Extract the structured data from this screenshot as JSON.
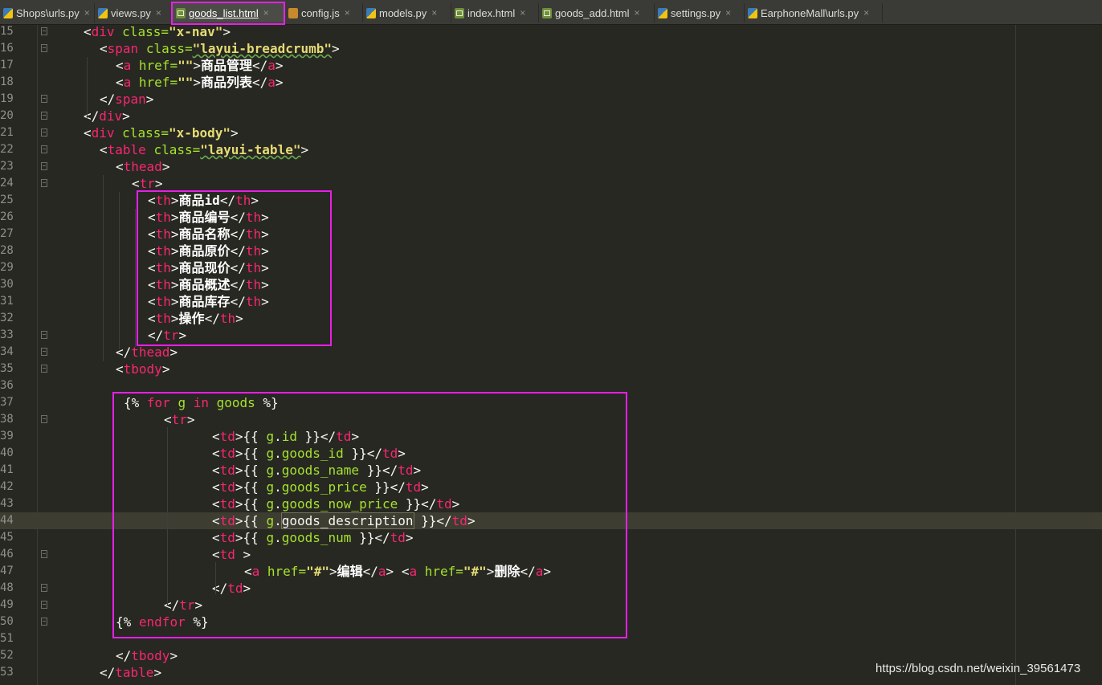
{
  "tabs": [
    {
      "label": "Shops\\urls.py",
      "icon": "python-file-icon",
      "active": false
    },
    {
      "label": "views.py",
      "icon": "python-file-icon",
      "active": false
    },
    {
      "label": "goods_list.html",
      "icon": "html-file-icon",
      "active": true
    },
    {
      "label": "config.js",
      "icon": "js-file-icon",
      "active": false
    },
    {
      "label": "models.py",
      "icon": "python-file-icon",
      "active": false
    },
    {
      "label": "index.html",
      "icon": "html-file-icon",
      "active": false
    },
    {
      "label": "goods_add.html",
      "icon": "html-file-icon",
      "active": false
    },
    {
      "label": "settings.py",
      "icon": "python-file-icon",
      "active": false
    },
    {
      "label": "EarphoneMall\\urls.py",
      "icon": "python-file-icon",
      "active": false
    }
  ],
  "tab_close_glyph": "×",
  "lines": [
    {
      "num": "15",
      "tokens": [
        [
          "punc",
          "<"
        ],
        [
          "tag",
          "div "
        ],
        [
          "attr",
          "class="
        ],
        [
          "str",
          "\"x-nav\""
        ],
        [
          "punc",
          ">"
        ]
      ]
    },
    {
      "num": "16",
      "tokens": [
        [
          "punc",
          "<"
        ],
        [
          "tag",
          "span "
        ],
        [
          "attr",
          "class="
        ],
        [
          "str",
          "\"layui-breadcrumb\""
        ],
        [
          "punc",
          ">"
        ]
      ]
    },
    {
      "num": "17",
      "tokens": [
        [
          "punc",
          "<"
        ],
        [
          "tag",
          "a "
        ],
        [
          "attr",
          "href="
        ],
        [
          "str",
          "\"\""
        ],
        [
          "punc",
          ">"
        ],
        [
          "txt",
          "商品管理"
        ],
        [
          "punc",
          "</"
        ],
        [
          "tag",
          "a"
        ],
        [
          "punc",
          ">"
        ]
      ]
    },
    {
      "num": "18",
      "tokens": [
        [
          "punc",
          "<"
        ],
        [
          "tag",
          "a "
        ],
        [
          "attr",
          "href="
        ],
        [
          "str",
          "\"\""
        ],
        [
          "punc",
          ">"
        ],
        [
          "txt",
          "商品列表"
        ],
        [
          "punc",
          "</"
        ],
        [
          "tag",
          "a"
        ],
        [
          "punc",
          ">"
        ]
      ]
    },
    {
      "num": "19",
      "tokens": [
        [
          "punc",
          "</"
        ],
        [
          "tag",
          "span"
        ],
        [
          "punc",
          ">"
        ]
      ]
    },
    {
      "num": "20",
      "tokens": [
        [
          "punc",
          "</"
        ],
        [
          "tag",
          "div"
        ],
        [
          "punc",
          ">"
        ]
      ]
    },
    {
      "num": "21",
      "tokens": [
        [
          "punc",
          "<"
        ],
        [
          "tag",
          "div "
        ],
        [
          "attr",
          "class="
        ],
        [
          "str",
          "\"x-body\""
        ],
        [
          "punc",
          ">"
        ]
      ]
    },
    {
      "num": "22",
      "tokens": [
        [
          "punc",
          "<"
        ],
        [
          "tag",
          "table "
        ],
        [
          "attr",
          "class="
        ],
        [
          "str",
          "\"layui-table\""
        ],
        [
          "punc",
          ">"
        ]
      ]
    },
    {
      "num": "23",
      "tokens": [
        [
          "punc",
          "<"
        ],
        [
          "tag",
          "thead"
        ],
        [
          "punc",
          ">"
        ]
      ]
    },
    {
      "num": "24",
      "tokens": [
        [
          "punc",
          "<"
        ],
        [
          "tag",
          "tr"
        ],
        [
          "punc",
          ">"
        ]
      ]
    },
    {
      "num": "25",
      "tokens": [
        [
          "punc",
          "<"
        ],
        [
          "tag",
          "th"
        ],
        [
          "punc",
          ">"
        ],
        [
          "txt",
          "商品id"
        ],
        [
          "punc",
          "</"
        ],
        [
          "tag",
          "th"
        ],
        [
          "punc",
          ">"
        ]
      ]
    },
    {
      "num": "26",
      "tokens": [
        [
          "punc",
          "<"
        ],
        [
          "tag",
          "th"
        ],
        [
          "punc",
          ">"
        ],
        [
          "txt",
          "商品编号"
        ],
        [
          "punc",
          "</"
        ],
        [
          "tag",
          "th"
        ],
        [
          "punc",
          ">"
        ]
      ]
    },
    {
      "num": "27",
      "tokens": [
        [
          "punc",
          "<"
        ],
        [
          "tag",
          "th"
        ],
        [
          "punc",
          ">"
        ],
        [
          "txt",
          "商品名称"
        ],
        [
          "punc",
          "</"
        ],
        [
          "tag",
          "th"
        ],
        [
          "punc",
          ">"
        ]
      ]
    },
    {
      "num": "28",
      "tokens": [
        [
          "punc",
          "<"
        ],
        [
          "tag",
          "th"
        ],
        [
          "punc",
          ">"
        ],
        [
          "txt",
          "商品原价"
        ],
        [
          "punc",
          "</"
        ],
        [
          "tag",
          "th"
        ],
        [
          "punc",
          ">"
        ]
      ]
    },
    {
      "num": "29",
      "tokens": [
        [
          "punc",
          "<"
        ],
        [
          "tag",
          "th"
        ],
        [
          "punc",
          ">"
        ],
        [
          "txt",
          "商品现价"
        ],
        [
          "punc",
          "</"
        ],
        [
          "tag",
          "th"
        ],
        [
          "punc",
          ">"
        ]
      ]
    },
    {
      "num": "30",
      "tokens": [
        [
          "punc",
          "<"
        ],
        [
          "tag",
          "th"
        ],
        [
          "punc",
          ">"
        ],
        [
          "txt",
          "商品概述"
        ],
        [
          "punc",
          "</"
        ],
        [
          "tag",
          "th"
        ],
        [
          "punc",
          ">"
        ]
      ]
    },
    {
      "num": "31",
      "tokens": [
        [
          "punc",
          "<"
        ],
        [
          "tag",
          "th"
        ],
        [
          "punc",
          ">"
        ],
        [
          "txt",
          "商品库存"
        ],
        [
          "punc",
          "</"
        ],
        [
          "tag",
          "th"
        ],
        [
          "punc",
          ">"
        ]
      ]
    },
    {
      "num": "32",
      "tokens": [
        [
          "punc",
          "<"
        ],
        [
          "tag",
          "th"
        ],
        [
          "punc",
          ">"
        ],
        [
          "txt",
          "操作"
        ],
        [
          "punc",
          "</"
        ],
        [
          "tag",
          "th"
        ],
        [
          "punc",
          ">"
        ]
      ]
    },
    {
      "num": "33",
      "tokens": [
        [
          "punc",
          "</"
        ],
        [
          "tag",
          "tr"
        ],
        [
          "punc",
          ">"
        ]
      ]
    },
    {
      "num": "34",
      "tokens": [
        [
          "punc",
          "</"
        ],
        [
          "tag",
          "thead"
        ],
        [
          "punc",
          ">"
        ]
      ]
    },
    {
      "num": "35",
      "tokens": [
        [
          "punc",
          "<"
        ],
        [
          "tag",
          "tbody"
        ],
        [
          "punc",
          ">"
        ]
      ]
    },
    {
      "num": "36",
      "tokens": []
    },
    {
      "num": "37",
      "tokens": [
        [
          "op",
          "{% "
        ],
        [
          "kw",
          "for "
        ],
        [
          "var",
          "g "
        ],
        [
          "kw",
          "in "
        ],
        [
          "var",
          "goods "
        ],
        [
          "op",
          "%}"
        ]
      ]
    },
    {
      "num": "38",
      "tokens": [
        [
          "punc",
          "<"
        ],
        [
          "tag",
          "tr"
        ],
        [
          "punc",
          ">"
        ]
      ]
    },
    {
      "num": "39",
      "tokens": [
        [
          "punc",
          "<"
        ],
        [
          "tag",
          "td"
        ],
        [
          "punc",
          ">"
        ],
        [
          "op",
          "{{ "
        ],
        [
          "var",
          "g"
        ],
        [
          "op",
          "."
        ],
        [
          "var",
          "id "
        ],
        [
          "op",
          "}}"
        ],
        [
          "punc",
          "</"
        ],
        [
          "tag",
          "td"
        ],
        [
          "punc",
          ">"
        ]
      ]
    },
    {
      "num": "40",
      "tokens": [
        [
          "punc",
          "<"
        ],
        [
          "tag",
          "td"
        ],
        [
          "punc",
          ">"
        ],
        [
          "op",
          "{{ "
        ],
        [
          "var",
          "g"
        ],
        [
          "op",
          "."
        ],
        [
          "var",
          "goods_id "
        ],
        [
          "op",
          "}}"
        ],
        [
          "punc",
          "</"
        ],
        [
          "tag",
          "td"
        ],
        [
          "punc",
          ">"
        ]
      ]
    },
    {
      "num": "41",
      "tokens": [
        [
          "punc",
          "<"
        ],
        [
          "tag",
          "td"
        ],
        [
          "punc",
          ">"
        ],
        [
          "op",
          "{{ "
        ],
        [
          "var",
          "g"
        ],
        [
          "op",
          "."
        ],
        [
          "var",
          "goods_name "
        ],
        [
          "op",
          "}}"
        ],
        [
          "punc",
          "</"
        ],
        [
          "tag",
          "td"
        ],
        [
          "punc",
          ">"
        ]
      ]
    },
    {
      "num": "42",
      "tokens": [
        [
          "punc",
          "<"
        ],
        [
          "tag",
          "td"
        ],
        [
          "punc",
          ">"
        ],
        [
          "op",
          "{{ "
        ],
        [
          "var",
          "g"
        ],
        [
          "op",
          "."
        ],
        [
          "var",
          "goods_price "
        ],
        [
          "op",
          "}}"
        ],
        [
          "punc",
          "</"
        ],
        [
          "tag",
          "td"
        ],
        [
          "punc",
          ">"
        ]
      ]
    },
    {
      "num": "43",
      "tokens": [
        [
          "punc",
          "<"
        ],
        [
          "tag",
          "td"
        ],
        [
          "punc",
          ">"
        ],
        [
          "op",
          "{{ "
        ],
        [
          "var",
          "g"
        ],
        [
          "op",
          "."
        ],
        [
          "var",
          "goods_now_price "
        ],
        [
          "op",
          "}}"
        ],
        [
          "punc",
          "</"
        ],
        [
          "tag",
          "td"
        ],
        [
          "punc",
          ">"
        ]
      ]
    },
    {
      "num": "44",
      "tokens": [
        [
          "punc",
          "<"
        ],
        [
          "tag",
          "td"
        ],
        [
          "punc",
          ">"
        ],
        [
          "op",
          "{{ "
        ],
        [
          "var",
          "g"
        ],
        [
          "op",
          "."
        ],
        [
          "hl",
          "goods_description"
        ],
        [
          "op",
          " }}"
        ],
        [
          "punc",
          "</"
        ],
        [
          "tag",
          "td"
        ],
        [
          "punc",
          ">"
        ]
      ]
    },
    {
      "num": "45",
      "tokens": [
        [
          "punc",
          "<"
        ],
        [
          "tag",
          "td"
        ],
        [
          "punc",
          ">"
        ],
        [
          "op",
          "{{ "
        ],
        [
          "var",
          "g"
        ],
        [
          "op",
          "."
        ],
        [
          "var",
          "goods_num "
        ],
        [
          "op",
          "}}"
        ],
        [
          "punc",
          "</"
        ],
        [
          "tag",
          "td"
        ],
        [
          "punc",
          ">"
        ]
      ]
    },
    {
      "num": "46",
      "tokens": [
        [
          "punc",
          "<"
        ],
        [
          "tag",
          "td "
        ],
        [
          "punc",
          ">"
        ]
      ]
    },
    {
      "num": "47",
      "tokens": [
        [
          "punc",
          "<"
        ],
        [
          "tag",
          "a "
        ],
        [
          "attr",
          "href="
        ],
        [
          "str",
          "\"#\""
        ],
        [
          "punc",
          ">"
        ],
        [
          "txt",
          "编辑"
        ],
        [
          "punc",
          "</"
        ],
        [
          "tag",
          "a"
        ],
        [
          "punc",
          "> <"
        ],
        [
          "tag",
          "a "
        ],
        [
          "attr",
          "href="
        ],
        [
          "str",
          "\"#\""
        ],
        [
          "punc",
          ">"
        ],
        [
          "txt",
          "删除"
        ],
        [
          "punc",
          "</"
        ],
        [
          "tag",
          "a"
        ],
        [
          "punc",
          ">"
        ]
      ]
    },
    {
      "num": "48",
      "tokens": [
        [
          "punc",
          "</"
        ],
        [
          "tag",
          "td"
        ],
        [
          "punc",
          ">"
        ]
      ]
    },
    {
      "num": "49",
      "tokens": [
        [
          "punc",
          "</"
        ],
        [
          "tag",
          "tr"
        ],
        [
          "punc",
          ">"
        ]
      ]
    },
    {
      "num": "50",
      "tokens": [
        [
          "op",
          "{% "
        ],
        [
          "kw",
          "endfor "
        ],
        [
          "op",
          "%}"
        ]
      ]
    },
    {
      "num": "51",
      "tokens": []
    },
    {
      "num": "52",
      "tokens": [
        [
          "punc",
          "</"
        ],
        [
          "tag",
          "tbody"
        ],
        [
          "punc",
          ">"
        ]
      ]
    },
    {
      "num": "53",
      "tokens": [
        [
          "punc",
          "</"
        ],
        [
          "tag",
          "table"
        ],
        [
          "punc",
          ">"
        ]
      ]
    }
  ],
  "current_line": "44",
  "watermark": "https://blog.csdn.net/weixin_39561473",
  "colors": {
    "background": "#272822",
    "tag": "#f92672",
    "attribute": "#a6e22e",
    "string": "#e6db74",
    "highlight_box": "#e81fe8"
  }
}
